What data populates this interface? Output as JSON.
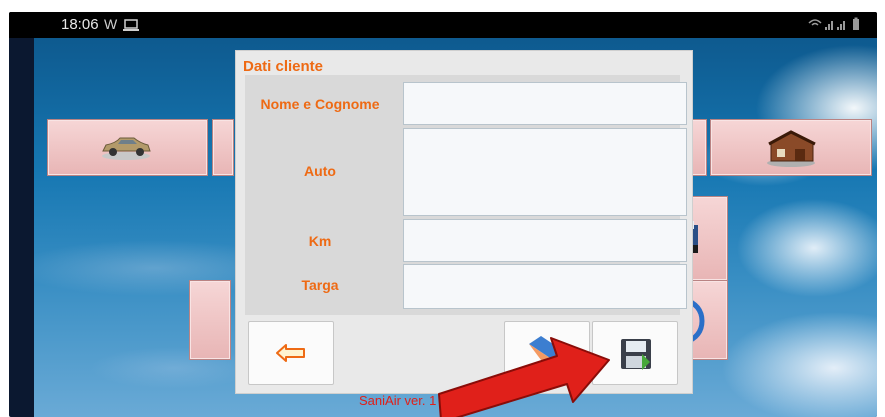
{
  "status_bar": {
    "time": "18:06",
    "notification_letter": "W"
  },
  "dialog": {
    "title": "Dati cliente",
    "fields": [
      {
        "label": "Nome e Cognome",
        "value": ""
      },
      {
        "label": "Auto",
        "value": ""
      },
      {
        "label": "Km",
        "value": ""
      },
      {
        "label": "Targa",
        "value": ""
      }
    ],
    "buttons": [
      "back-arrow-icon",
      "eraser-icon",
      "save-floppy-icon"
    ]
  },
  "footer": {
    "version_text": "SaniAir ver. 1"
  },
  "background_tiles": [
    "car-icon",
    "house-icon",
    "printer-icon",
    "refresh-icon"
  ],
  "colors": {
    "accent": "#ee6a14",
    "tile": "#e8b5b5",
    "pointer_arrow": "#e0201a"
  }
}
